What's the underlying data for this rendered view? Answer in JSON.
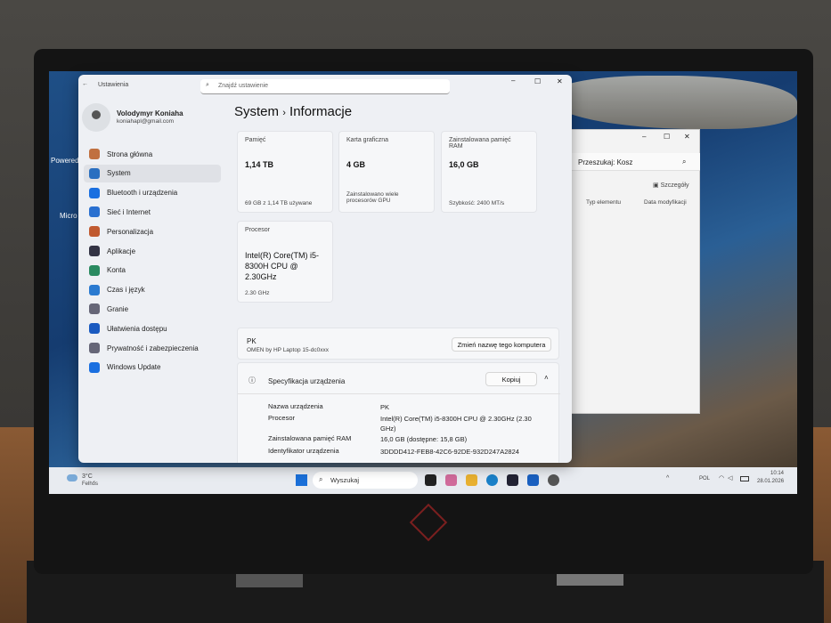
{
  "settings": {
    "app_title": "Ustawienia",
    "search_placeholder": "Znajdź ustawienie",
    "user": {
      "name": "Volodymyr Koniaha",
      "email": "koniahapl@gmail.com"
    },
    "nav": [
      {
        "label": "Strona główna",
        "color": "#c07040"
      },
      {
        "label": "System",
        "color": "#2a6fc0"
      },
      {
        "label": "Bluetooth i urządzenia",
        "color": "#1a6fe0"
      },
      {
        "label": "Sieć i Internet",
        "color": "#2a70d0"
      },
      {
        "label": "Personalizacja",
        "color": "#c05a30"
      },
      {
        "label": "Aplikacje",
        "color": "#334"
      },
      {
        "label": "Konta",
        "color": "#2a8a60"
      },
      {
        "label": "Czas i język",
        "color": "#2a7ad0"
      },
      {
        "label": "Granie",
        "color": "#667"
      },
      {
        "label": "Ułatwienia dostępu",
        "color": "#1a5ac0"
      },
      {
        "label": "Prywatność i zabezpieczenia",
        "color": "#667"
      },
      {
        "label": "Windows Update",
        "color": "#1a6fe0"
      }
    ],
    "breadcrumb": {
      "parent": "System",
      "separator": "›",
      "current": "Informacje"
    },
    "cards": {
      "storage": {
        "label": "Pamięć",
        "value": "1,14 TB",
        "sub": "69 GB z 1,14 TB używane"
      },
      "gpu": {
        "label": "Karta graficzna",
        "value": "4 GB",
        "sub": "Zainstalowano wiele procesorów GPU"
      },
      "ram": {
        "label": "Zainstalowana pamięć RAM",
        "value": "16,0 GB",
        "sub": "Szybkość: 2400 MT/s"
      },
      "cpu": {
        "label": "Procesor",
        "value": "Intel(R) Core(TM) i5-8300H CPU @ 2.30GHz",
        "sub": "2.30 GHz"
      }
    },
    "device": {
      "name": "PK",
      "model": "OMEN by HP Laptop 15-dc0xxx",
      "rename_button": "Zmień nazwę tego komputera"
    },
    "spec": {
      "title": "Specyfikacja urządzenia",
      "copy_button": "Kopiuj",
      "rows": [
        {
          "k": "Nazwa urządzenia",
          "v": "PK"
        },
        {
          "k": "Procesor",
          "v": "Intel(R) Core(TM) i5-8300H CPU @ 2.30GHz (2.30 GHz)"
        },
        {
          "k": "Zainstalowana pamięć RAM",
          "v": "16,0 GB (dostępne: 15,8 GB)"
        },
        {
          "k": "Identyfikator urządzenia",
          "v": "3DDDD412-FEB8-42C6-92DE-932D247A2824"
        }
      ]
    }
  },
  "explorer": {
    "search": "Przeszukaj: Kosz",
    "details_button": "Szczegóły",
    "col_type": "Typ elementu",
    "col_date": "Data modyfikacji"
  },
  "desktop": {
    "icon1": "Powered by Zym",
    "icon2": "Micro"
  },
  "taskbar": {
    "temp": "3°C",
    "weather": "Felhős",
    "search": "Wyszukaj",
    "lang": "POL",
    "time": "10:14",
    "date": "28.01.2026"
  }
}
